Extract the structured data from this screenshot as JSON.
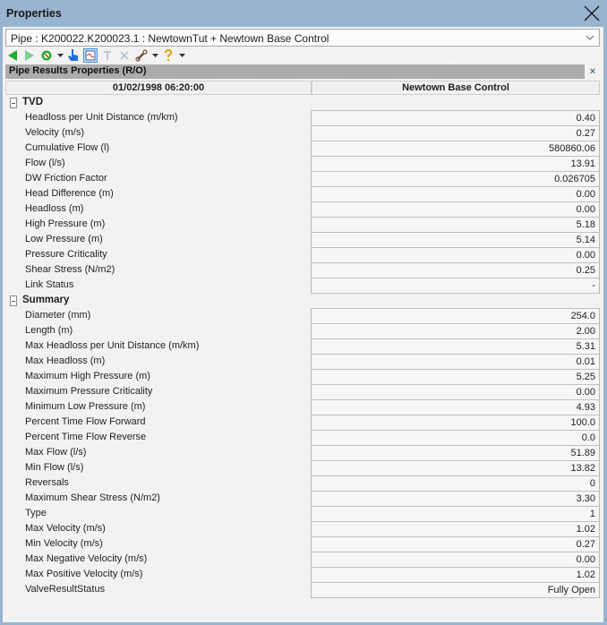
{
  "window": {
    "title": "Properties",
    "close_label": "Close"
  },
  "selector": {
    "value": "Pipe : K200022.K200023.1 : NewtownTut + Newtown Base Control"
  },
  "toolbar": {
    "icons": [
      "back-arrow-icon",
      "forward-arrow-icon",
      "target-icon",
      "dropdown-arrow-icon",
      "pointer-hand-icon",
      "graph-view-icon",
      "text-icon",
      "delete-icon",
      "wrench-icon",
      "dropdown-arrow-icon",
      "help-icon",
      "dropdown-arrow-icon"
    ]
  },
  "section": {
    "title": "Pipe Results Properties (R/O)",
    "close_glyph": "×"
  },
  "columns": {
    "timestamp": "01/02/1998 06:20:00",
    "scenario": "Newtown Base Control"
  },
  "groups": [
    {
      "name": "TVD",
      "rows": [
        {
          "label": "Headloss per Unit Distance (m/km)",
          "value": "0.40"
        },
        {
          "label": "Velocity (m/s)",
          "value": "0.27"
        },
        {
          "label": "Cumulative Flow (l)",
          "value": "580860.06"
        },
        {
          "label": "Flow (l/s)",
          "value": "13.91"
        },
        {
          "label": "DW Friction Factor",
          "value": "0.026705"
        },
        {
          "label": "Head Difference (m)",
          "value": "0.00"
        },
        {
          "label": "Headloss (m)",
          "value": "0.00"
        },
        {
          "label": "High Pressure (m)",
          "value": "5.18"
        },
        {
          "label": "Low Pressure (m)",
          "value": "5.14"
        },
        {
          "label": "Pressure Criticality",
          "value": "0.00"
        },
        {
          "label": "Shear Stress (N/m2)",
          "value": "0.25"
        },
        {
          "label": "Link Status",
          "value": "-"
        }
      ]
    },
    {
      "name": "Summary",
      "rows": [
        {
          "label": "Diameter (mm)",
          "value": "254.0"
        },
        {
          "label": "Length (m)",
          "value": "2.00"
        },
        {
          "label": "Max Headloss per Unit Distance (m/km)",
          "value": "5.31"
        },
        {
          "label": "Max Headloss (m)",
          "value": "0.01"
        },
        {
          "label": "Maximum High Pressure (m)",
          "value": "5.25"
        },
        {
          "label": "Maximum Pressure Criticality",
          "value": "0.00"
        },
        {
          "label": "Minimum Low Pressure (m)",
          "value": "4.93"
        },
        {
          "label": "Percent Time Flow Forward",
          "value": "100.0"
        },
        {
          "label": "Percent Time Flow Reverse",
          "value": "0.0"
        },
        {
          "label": "Max Flow (l/s)",
          "value": "51.89"
        },
        {
          "label": "Min Flow (l/s)",
          "value": "13.82"
        },
        {
          "label": "Reversals",
          "value": "0"
        },
        {
          "label": "Maximum Shear Stress (N/m2)",
          "value": "3.30"
        },
        {
          "label": "Type",
          "value": "1"
        },
        {
          "label": "Max Velocity (m/s)",
          "value": "1.02"
        },
        {
          "label": "Min Velocity (m/s)",
          "value": "0.27"
        },
        {
          "label": "Max Negative Velocity (m/s)",
          "value": "0.00"
        },
        {
          "label": "Max Positive Velocity (m/s)",
          "value": "1.02"
        },
        {
          "label": "ValveResultStatus",
          "value": "Fully Open"
        }
      ]
    }
  ]
}
